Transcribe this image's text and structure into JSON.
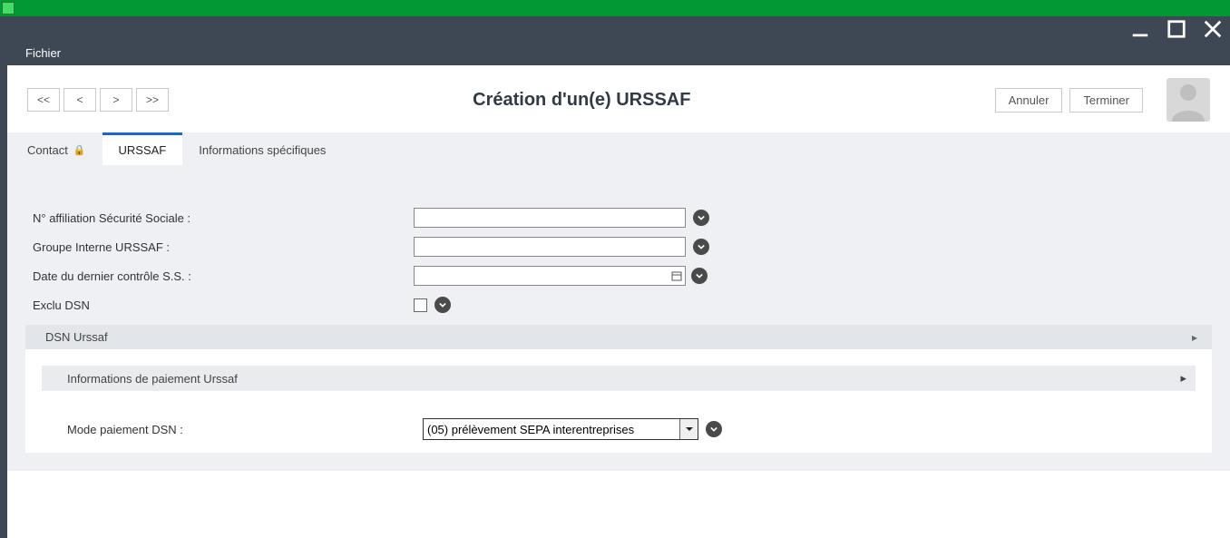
{
  "menu": {
    "fichier": "Fichier"
  },
  "nav": {
    "first": "<<",
    "prev": "<",
    "next": ">",
    "last": ">>"
  },
  "header": {
    "title": "Création d'un(e) URSSAF",
    "cancel": "Annuler",
    "finish": "Terminer"
  },
  "tabs": {
    "contact": "Contact",
    "urssaf": "URSSAF",
    "info_spec": "Informations spécifiques"
  },
  "form": {
    "affiliation_label": "N° affiliation Sécurité Sociale :",
    "affiliation_value": "",
    "groupe_label": "Groupe Interne URSSAF :",
    "groupe_value": "",
    "date_label": "Date du dernier contrôle S.S. :",
    "date_value": "",
    "exclu_label": "Exclu DSN"
  },
  "sections": {
    "dsn_urssaf": "DSN Urssaf",
    "info_paiement": "Informations de paiement Urssaf"
  },
  "paiement": {
    "mode_label": "Mode paiement DSN :",
    "mode_value": "(05) prélèvement SEPA interentreprises"
  }
}
